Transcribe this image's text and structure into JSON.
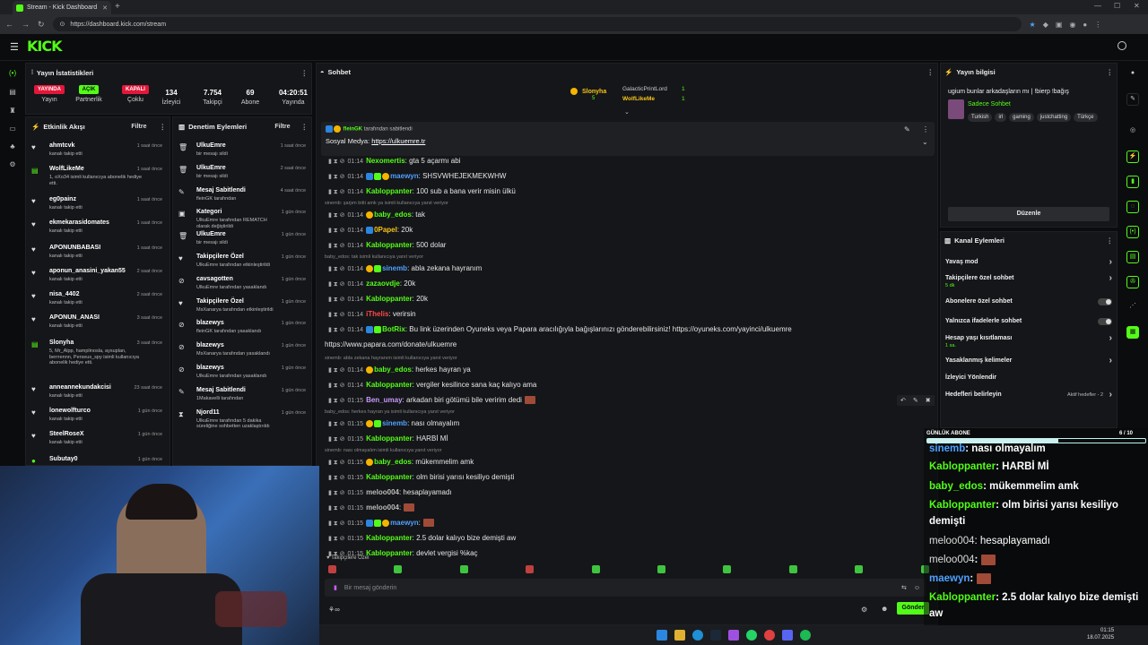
{
  "browser": {
    "tab_title": "Stream - Kick Dashboard",
    "url": "https://dashboard.kick.com/stream"
  },
  "logo": "KICK",
  "stats": {
    "title": "Yayın İstatistikleri",
    "cols": [
      {
        "badge": "YAYINDA",
        "label": "Yayın"
      },
      {
        "badge": "AÇIK",
        "label": "Partnerlik"
      },
      {
        "badge": "KAPALI",
        "label": "Çoklu"
      },
      {
        "value": "134",
        "label": "İzleyici"
      },
      {
        "value": "7.754",
        "label": "Takipçi"
      },
      {
        "value": "69",
        "label": "Abone"
      },
      {
        "value": "04:20:51",
        "label": "Yayında"
      }
    ]
  },
  "events": {
    "title": "Etkinlik Akışı",
    "filter": "Filtre",
    "items": [
      {
        "name": "ahmtcvk",
        "sub": "kanalı takip etti",
        "time": "1 saat önce"
      },
      {
        "name": "WolfLikeMe",
        "sub": "1, oXo34 isimli kullanıcıya abonelik hediye etti.",
        "time": "1 saat önce"
      },
      {
        "name": "eg0painz",
        "sub": "kanalı takip etti",
        "time": "1 saat önce"
      },
      {
        "name": "ekmekarasidomates",
        "sub": "kanalı takip etti",
        "time": "1 saat önce"
      },
      {
        "name": "APONUNBABASI",
        "sub": "kanalı takip etti",
        "time": "1 saat önce"
      },
      {
        "name": "aponun_anasini_yakan55",
        "sub": "kanalı takip etti",
        "time": "2 saat önce"
      },
      {
        "name": "nisa_4402",
        "sub": "kanalı takip etti",
        "time": "2 saat önce"
      },
      {
        "name": "APONUN_ANASI",
        "sub": "kanalı takip etti",
        "time": "3 saat önce"
      },
      {
        "name": "Slonyha",
        "sub": "5, Mr_Alpp, hamplinosla, aysuplan, berrrennn, Perseus_spy isimli kullanıcıya abonelik hediye etti.",
        "time": "3 saat önce"
      },
      {
        "name": "anneannekundakcisi",
        "sub": "kanalı takip etti",
        "time": "23 saat önce"
      },
      {
        "name": "lonewolfturco",
        "sub": "kanalı takip etti",
        "time": "1 gün önce"
      },
      {
        "name": "SteelRoseX",
        "sub": "kanalı takip etti",
        "time": "1 gün önce"
      },
      {
        "name": "Subutay0",
        "sub": "",
        "time": "1 gün önce"
      }
    ]
  },
  "moderation": {
    "title": "Denetim Eylemleri",
    "filter": "Filtre",
    "items": [
      {
        "name": "UlkuEmre",
        "sub": "bir mesajı sildi",
        "time": "1 saat önce"
      },
      {
        "name": "UlkuEmre",
        "sub": "bir mesajı sildi",
        "time": "2 saat önce"
      },
      {
        "name": "Mesaj Sabitlendi",
        "sub": "fleinGK tarafından",
        "time": "4 saat önce"
      },
      {
        "name": "Kategori",
        "sub": "UlkuEmre tarafından REMATCH olarak değiştirildi",
        "time": "1 gün önce"
      },
      {
        "name": "UlkuEmre",
        "sub": "bir mesajı sildi",
        "time": "1 gün önce"
      },
      {
        "name": "Takipçilere Özel",
        "sub": "UlkuEmre tarafından etkinleştirildi",
        "time": "1 gün önce"
      },
      {
        "name": "cavsagotten",
        "sub": "UlkuEmre tarafından yasaklandı",
        "time": "1 gün önce"
      },
      {
        "name": "Takipçilere Özel",
        "sub": "MsXanarya tarafından etkinleştirildi",
        "time": "1 gün önce"
      },
      {
        "name": "blazewys",
        "sub": "fleinGK tarafından yasaklandı",
        "time": "1 gün önce"
      },
      {
        "name": "blazewys",
        "sub": "MsXanarya tarafından yasaklandı",
        "time": "1 gün önce"
      },
      {
        "name": "blazewys",
        "sub": "UlkuEmre tarafından yasaklandı",
        "time": "1 gün önce"
      },
      {
        "name": "Mesaj Sabitlendi",
        "sub": "1Makavelli tarafından",
        "time": "1 gün önce"
      },
      {
        "name": "Njord11",
        "sub": "UlkuEmre tarafından 5 dakika süreliğine sohbetten uzaklaştırıldı",
        "time": "1 gün önce"
      }
    ]
  },
  "chat": {
    "title": "Sohbet",
    "top": {
      "gifter": "Slonyha",
      "gifter_count": "5",
      "u1": "GalacticPrintLord",
      "u1_n": "1",
      "u2": "WolfLikeMe",
      "u2_n": "1"
    },
    "pinned": {
      "by": "fleinGK",
      "by_suffix": "tarafından sabitlendi",
      "text": "Sosyal Medya:",
      "link": "https://ulkuemre.tr"
    },
    "messages": [
      {
        "time": "01:14",
        "user": "Nexomertis",
        "color": "ug",
        "text": ": gta 5 açarmı abi"
      },
      {
        "time": "01:14",
        "user": "maewyn",
        "color": "ublue",
        "text": ": SHSVWHEJEKMEKWHW"
      },
      {
        "time": "01:14",
        "user": "Kabloppanter",
        "color": "ug",
        "text": ": 100 sub a bana verir misin ülkü"
      },
      {
        "reply": "sinemb: şarjım bitti amk ya isimli kullanıcıya yanıt veriyor"
      },
      {
        "time": "01:14",
        "user": "baby_edos",
        "color": "ug",
        "text": ": tak"
      },
      {
        "time": "01:14",
        "user": "0Papel",
        "color": "uy",
        "text": ": 20k"
      },
      {
        "time": "01:14",
        "user": "Kabloppanter",
        "color": "ug",
        "text": ": 500 dolar"
      },
      {
        "reply": "baby_edos: tak isimli kullanıcıya yanıt veriyor"
      },
      {
        "time": "01:14",
        "user": "sinemb",
        "color": "ublue",
        "text": ": abla zekana hayranım"
      },
      {
        "time": "01:14",
        "user": "zazaovdje",
        "color": "ug",
        "text": ": 20k"
      },
      {
        "time": "01:14",
        "user": "Kabloppanter",
        "color": "ug",
        "text": ": 20k"
      },
      {
        "time": "01:14",
        "user": "iThelis",
        "color": "ured",
        "text": ": verirsin"
      },
      {
        "time": "01:14",
        "user": "BotRix",
        "color": "ug",
        "text": ": Bu link üzerinden Oyuneks veya Papara aracılığıyla bağışlarınızı gönderebilirsiniz! https://oyuneks.com/yayinci/ulkuemre"
      },
      {
        "cont": "https://www.papara.com/donate/ulkuemre"
      },
      {
        "reply": "sinemb: abla zekana hayranım isimli kullanıcıya yanıt veriyor"
      },
      {
        "time": "01:14",
        "user": "baby_edos",
        "color": "ug",
        "text": ": herkes hayran ya"
      },
      {
        "time": "01:14",
        "user": "Kabloppanter",
        "color": "ug",
        "text": ": vergiler kesilince sana kaç kalıyo ama"
      },
      {
        "time": "01:15",
        "user": "Ben_umay",
        "color": "upurple",
        "text": ": arkadan biri götümü bile veririm dedi"
      },
      {
        "reply": "baby_edos: herkes hayran ya isimli kullanıcıya yanıt veriyor"
      },
      {
        "time": "01:15",
        "user": "sinemb",
        "color": "ublue",
        "text": ": nası olmayalım"
      },
      {
        "time": "01:15",
        "user": "Kabloppanter",
        "color": "ug",
        "text": ": HARBİ Mİ"
      },
      {
        "reply": "sinemb: nası olmayalım isimli kullanıcıya yanıt veriyor"
      },
      {
        "time": "01:15",
        "user": "baby_edos",
        "color": "ug",
        "text": ": mükemmelim amk"
      },
      {
        "time": "01:15",
        "user": "Kabloppanter",
        "color": "ug",
        "text": ": olm birisi yarısı kesiliyo demişti"
      },
      {
        "time": "01:15",
        "user": "meloo004",
        "color": "ugrey",
        "text": ": hesaplayamadı"
      },
      {
        "time": "01:15",
        "user": "meloo004",
        "color": "ugrey",
        "text": ":"
      },
      {
        "time": "01:15",
        "user": "maewyn",
        "color": "ublue",
        "text": ":"
      },
      {
        "time": "01:15",
        "user": "Kabloppanter",
        "color": "ug",
        "text": ": 2.5 dolar kalıyo bize demişti aw"
      },
      {
        "time": "01:15",
        "user": "Kabloppanter",
        "color": "ug",
        "text": ": devlet vergisi %kaç"
      }
    ],
    "followers_only": "Takipçilere Özel",
    "input_placeholder": "Bir mesaj gönderin",
    "send": "Gönder"
  },
  "info": {
    "title": "Yayın bilgisi",
    "stream_title": "ugium bunlar arkadaşların mı | !bierp !bağış",
    "mode": "Sadece Sohbet",
    "tags": [
      "Turkish",
      "irl",
      "gaming",
      "justchatting",
      "Türkçe"
    ],
    "edit": "Düzenle"
  },
  "actions": {
    "title": "Kanal Eylemleri",
    "items": [
      {
        "label": "Yavaş mod",
        "kind": "chev"
      },
      {
        "label": "Takipçilere özel sohbet",
        "sub": "5 dk",
        "kind": "chev"
      },
      {
        "label": "Abonelere özel sohbet",
        "kind": "toggle"
      },
      {
        "label": "Yalnızca ifadelerle sohbet",
        "kind": "toggle"
      },
      {
        "label": "Hesap yaşı kısıtlaması",
        "sub": "1 sa.",
        "kind": "chev"
      },
      {
        "label": "Yasaklanmış kelimeler",
        "kind": "chev"
      },
      {
        "label": "İzleyici Yönlendir",
        "kind": "none"
      },
      {
        "label": "Hedefleri belirleyin",
        "sub": "Aktif hedefler - 2",
        "kind": "chev"
      }
    ]
  },
  "goal": {
    "label": "GÜNLÜK ABONE",
    "value": "6 / 10",
    "progress": 0.6
  },
  "overlay": [
    {
      "user": "sinemb",
      "text": ": nası olmayalım"
    },
    {
      "user": "Kabloppanter",
      "text": ": HARBİ Mİ"
    },
    {
      "user": "baby_edos",
      "text": ": mükemmelim amk"
    },
    {
      "user": "Kabloppanter",
      "text": ": olm birisi yarısı kesiliyo"
    },
    {
      "user": "",
      "text": "demişti"
    },
    {
      "user": "meloo004",
      "text": ": hesaplayamadı"
    },
    {
      "user": "meloo004",
      "text": ":"
    },
    {
      "user": "maewyn",
      "text": ":"
    },
    {
      "user": "Kabloppanter",
      "text": ": 2.5 dolar kalıyo bize demişti"
    },
    {
      "user": "",
      "text": "aw"
    },
    {
      "user": "Kabloppanter",
      "text": ": devlet vergisi %kaç"
    }
  ],
  "clock": {
    "time": "01:15",
    "date": "18.07.2025"
  }
}
